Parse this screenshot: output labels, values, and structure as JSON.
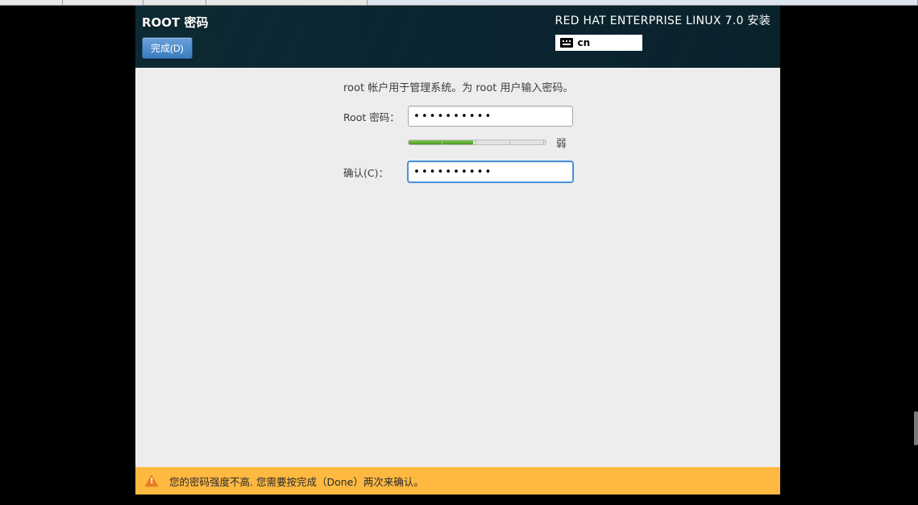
{
  "header": {
    "page_title": "ROOT 密码",
    "done_label": "完成(D)",
    "distro_title": "RED HAT ENTERPRISE LINUX 7.0 安装",
    "keyboard_layout": "cn"
  },
  "form": {
    "description": "root 帐户用于管理系统。为 root 用户输入密码。",
    "password_label": "Root 密码：",
    "password_value": "••••••••••",
    "confirm_label": "确认(C)：",
    "confirm_value": "••••••••••",
    "strength": {
      "percent": 47,
      "label": "弱"
    }
  },
  "warning": {
    "message": "您的密码强度不高. 您需要按完成（Done）两次来确认。"
  },
  "colors": {
    "header_bg": "#0a2832",
    "button_blue": "#3a7dc0",
    "warning_bg": "#ffb941",
    "strength_green": "#4a9820"
  }
}
